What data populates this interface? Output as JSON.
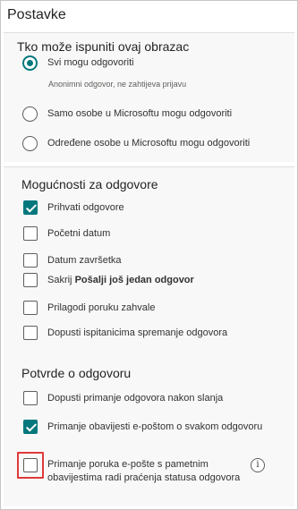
{
  "panel": {
    "title": "Postavke"
  },
  "who_can_fill": {
    "title": "Tko može ispuniti ovaj obrazac",
    "options": [
      {
        "label": "Svi mogu odgovoriti",
        "checked": true
      },
      {
        "label": "Samo osobe u Microsoftu mogu odgovoriti",
        "checked": false
      },
      {
        "label": "Određene osobe u Microsoftu mogu odgovoriti",
        "checked": false
      }
    ],
    "anonymous_note": "Anonimni odgovor, ne zahtijeva prijavu"
  },
  "response_options": {
    "title": "Mogućnosti za odgovore",
    "accept_responses": "Prihvati odgovore",
    "start_date": "Početni datum",
    "end_date": "Datum završetka",
    "hide_prefix": "Sakrij ",
    "hide_bold": "Pošalji još jedan odgovor",
    "custom_thanks": "Prilagodi poruku zahvale",
    "allow_save": "Dopusti ispitanicima spremanje odgovora"
  },
  "receipts": {
    "title": "Potvrde o odgovoru",
    "allow_receipt": "Dopusti primanje odgovora nakon slanja",
    "email_notification": "Primanje obavijesti e-poštom o svakom odgovoru",
    "smart_email_line1": "Primanje poruka e-pošte s pametnim",
    "smart_email_line2": "obavijestima radi praćenja statusa odgovora"
  },
  "colors": {
    "accent": "#03787c",
    "highlight": "#e0393a"
  },
  "icons": {
    "info": "info-icon",
    "info_glyph": "i"
  }
}
